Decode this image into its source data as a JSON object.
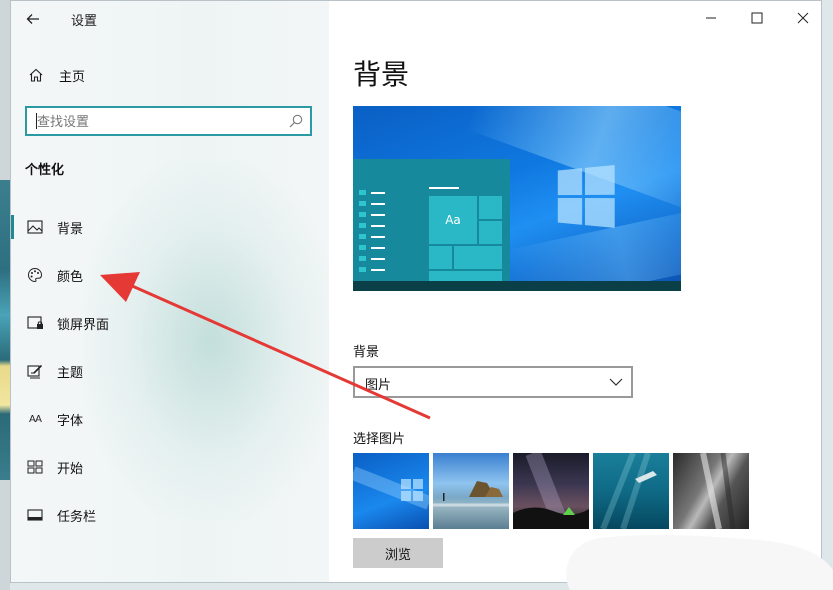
{
  "window": {
    "title": "设置",
    "back_icon": "arrow-left-icon"
  },
  "window_controls": [
    "minimize-icon",
    "maximize-icon",
    "close-icon"
  ],
  "sidebar": {
    "home": {
      "label": "主页",
      "icon": "home-icon"
    },
    "search": {
      "placeholder": "查找设置",
      "icon": "search-icon"
    },
    "section_label": "个性化",
    "items": [
      {
        "label": "背景",
        "icon": "picture-icon",
        "active": true
      },
      {
        "label": "颜色",
        "icon": "palette-icon",
        "active": false
      },
      {
        "label": "锁屏界面",
        "icon": "lock-screen-icon",
        "active": false
      },
      {
        "label": "主题",
        "icon": "theme-brush-icon",
        "active": false
      },
      {
        "label": "字体",
        "icon": "font-icon",
        "icon_text": "AA",
        "active": false
      },
      {
        "label": "开始",
        "icon": "start-grid-icon",
        "active": false
      },
      {
        "label": "任务栏",
        "icon": "taskbar-icon",
        "active": false
      }
    ]
  },
  "main": {
    "title": "背景",
    "preview": {
      "tile_text": "Aa"
    },
    "background_field": {
      "label": "背景",
      "value": "图片"
    },
    "choose_picture": {
      "label": "选择图片",
      "thumbnails": [
        "windows-blue",
        "beach-rocks",
        "night-sky-tent",
        "underwater-swimmer",
        "rock-cliff"
      ]
    },
    "browse_button": {
      "label": "浏览"
    }
  },
  "annotation": {
    "type": "red-arrow",
    "color": "#e53935",
    "points_to": "颜色"
  },
  "colors": {
    "accent": "#2b9aa5",
    "active_indicator": "#1e8a92"
  }
}
